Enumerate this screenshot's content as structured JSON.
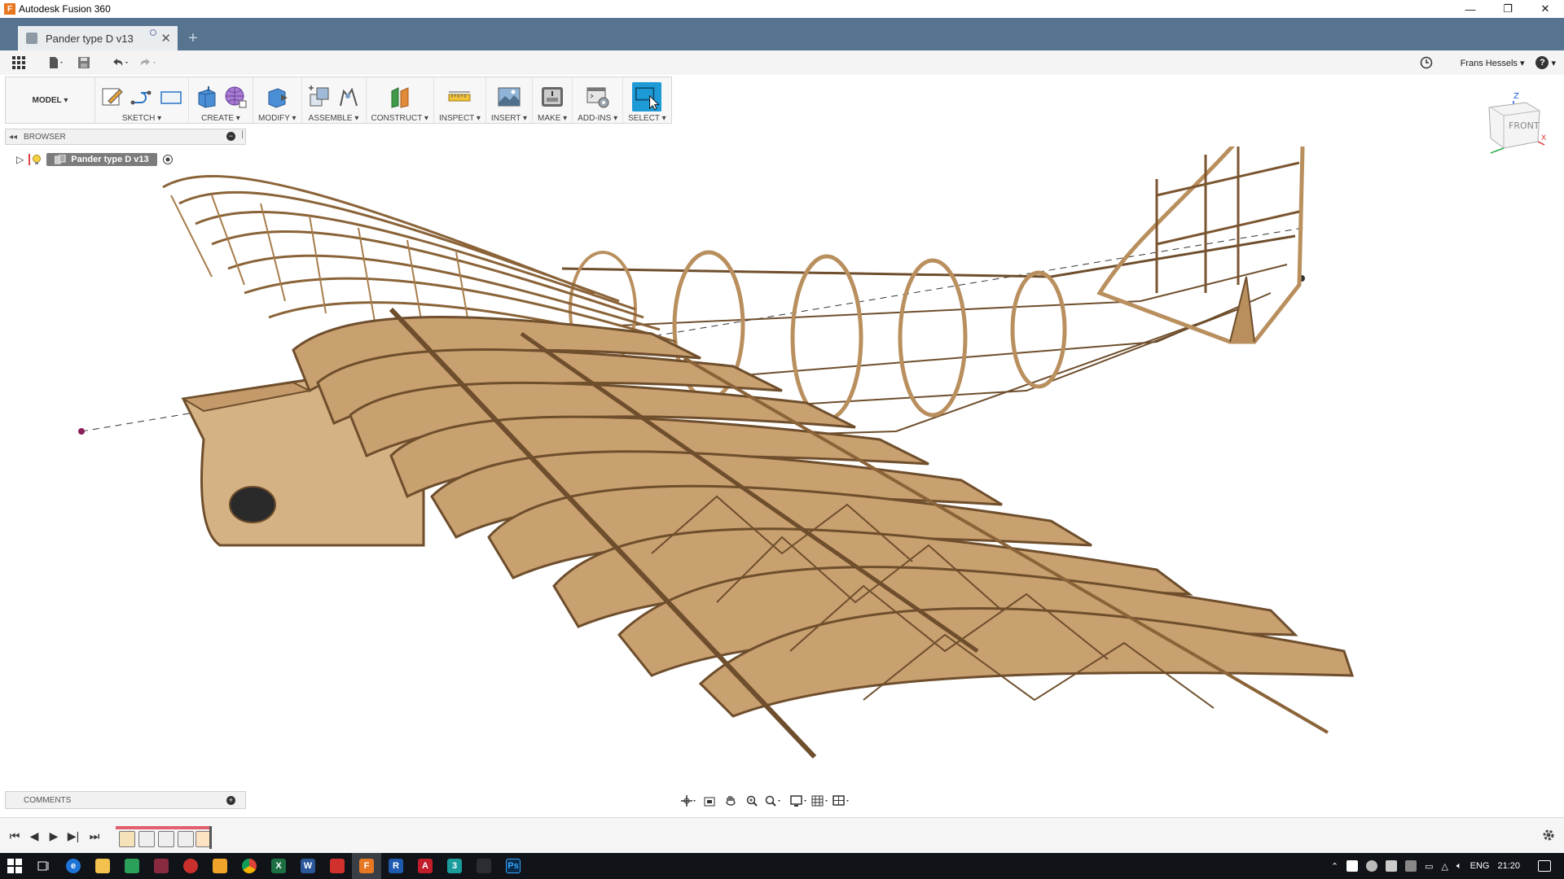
{
  "window": {
    "title": "Autodesk Fusion 360",
    "app_icon": "F",
    "controls": {
      "minimize": "—",
      "restore": "❐",
      "close": "✕"
    }
  },
  "document_tab": {
    "label": "Pander type D v13",
    "close": "✕",
    "new_tab": "+"
  },
  "quick_access": {
    "user_name": "Frans Hessels",
    "help": "?"
  },
  "toolbar": {
    "mode": "MODEL",
    "groups": [
      {
        "label": "SKETCH"
      },
      {
        "label": "CREATE"
      },
      {
        "label": "MODIFY"
      },
      {
        "label": "ASSEMBLE"
      },
      {
        "label": "CONSTRUCT"
      },
      {
        "label": "INSPECT"
      },
      {
        "label": "INSERT"
      },
      {
        "label": "MAKE"
      },
      {
        "label": "ADD-INS"
      },
      {
        "label": "SELECT"
      }
    ]
  },
  "browser": {
    "title": "BROWSER",
    "root_node": "Pander type D v13"
  },
  "viewcube": {
    "face": "FRONT",
    "axis_z": "Z",
    "axis_x": "X"
  },
  "comments": {
    "title": "COMMENTS"
  },
  "taskbar": {
    "language": "ENG",
    "time": "21:20",
    "app_letters": {
      "fusion": "F",
      "revit": "R",
      "acad": "A",
      "three": "3",
      "ps": "Ps",
      "word": "W",
      "excel": "X"
    }
  },
  "colors": {
    "tabbar": "#56738f",
    "wood": "#c9a070",
    "wood_dark": "#6e4e2c",
    "select_blue": "#1e9bd7"
  }
}
